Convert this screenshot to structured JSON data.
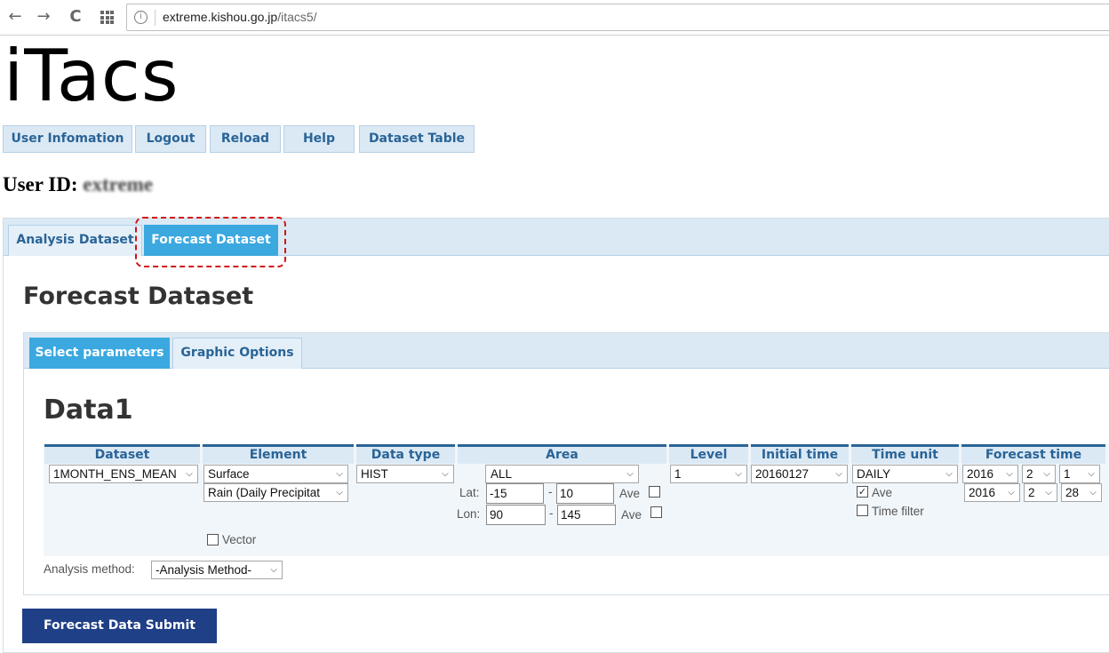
{
  "browser": {
    "url_host": "extreme.kishou.go.jp",
    "url_path": "/itacs5/",
    "nav": {
      "back": "←",
      "forward": "→",
      "reload": "C"
    }
  },
  "app": {
    "logo": "iTacs"
  },
  "top_buttons": [
    "User Infomation",
    "Logout",
    "Reload",
    "Help",
    "Dataset Table"
  ],
  "user": {
    "label": "User ID:",
    "id": "extreme"
  },
  "main_tabs": [
    "Analysis Dataset",
    "Forecast Dataset"
  ],
  "active_main_tab": "Forecast Dataset",
  "section_title": "Forecast Dataset",
  "sub_tabs": [
    "Select parameters",
    "Graphic Options"
  ],
  "active_sub_tab": "Select parameters",
  "data_title": "Data1",
  "columns": [
    "Dataset",
    "Element",
    "Data type",
    "Area",
    "Level",
    "Initial time",
    "Time unit",
    "Forecast time"
  ],
  "params": {
    "dataset": "1MONTH_ENS_MEAN",
    "element_category": "Surface",
    "element": "Rain (Daily Precipitat",
    "vector_label": "Vector",
    "vector_checked": false,
    "data_type": "HIST",
    "area": "ALL",
    "lat_label": "Lat:",
    "lat_from": "-15",
    "lat_to": "10",
    "lon_label": "Lon:",
    "lon_from": "90",
    "lon_to": "145",
    "range_sep": "-",
    "ave_label": "Ave",
    "lat_ave_checked": false,
    "lon_ave_checked": false,
    "level": "1",
    "initial_time": "20160127",
    "time_unit": "DAILY",
    "time_ave_checked": true,
    "time_filter_label": "Time filter",
    "time_filter_checked": false,
    "forecast_start": {
      "year": "2016",
      "month": "2",
      "day": "1"
    },
    "forecast_end": {
      "year": "2016",
      "month": "2",
      "day": "28"
    }
  },
  "analysis_method": {
    "label": "Analysis method:",
    "value": "-Analysis Method-"
  },
  "submit_label": "Forecast Data Submit",
  "colors": {
    "tab_active": "#3ba8df",
    "submit_bg": "#1f3f86",
    "highlight": "#d11414",
    "header_text": "#2a6496"
  }
}
